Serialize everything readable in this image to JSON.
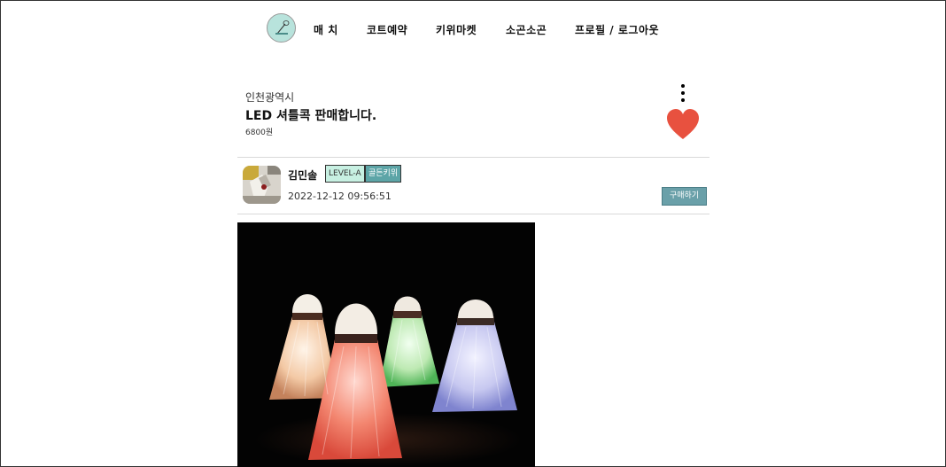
{
  "nav": {
    "logo_icon": "badminton-logo-icon",
    "items": [
      {
        "label": "매 치"
      },
      {
        "label": "코트예약"
      },
      {
        "label": "키위마켓"
      },
      {
        "label": "소곤소곤"
      },
      {
        "label": "프로필 / 로그아웃"
      }
    ]
  },
  "post": {
    "region": "인천광역시",
    "title": "LED 셔틀콕 판매합니다.",
    "price": "6800원",
    "more_icon": "kebab-menu-icon",
    "like_icon": "heart-icon",
    "like_color": "#e8513f"
  },
  "seller": {
    "name": "김민솔",
    "level_badge": "LEVEL-A",
    "grade_badge": "골든키위",
    "datetime": "2022-12-12 09:56:51",
    "buy_label": "구매하기"
  },
  "colors": {
    "accent": "#6aa0a9",
    "level_badge_bg": "#c7f0e2",
    "grade_badge_bg": "#5da5a7",
    "logo_bg": "#b8e3dc"
  }
}
